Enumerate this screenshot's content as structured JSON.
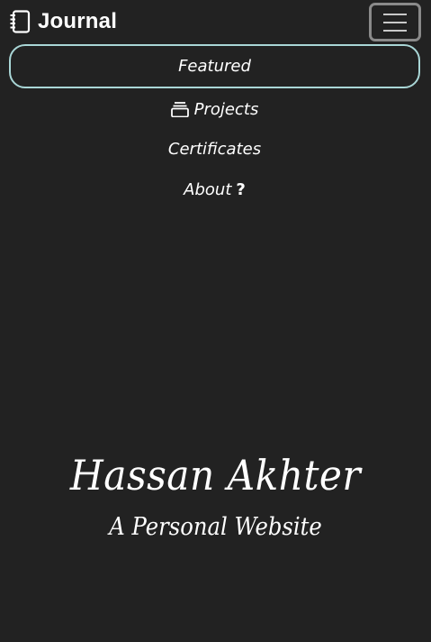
{
  "navbar": {
    "brand_title": "Journal",
    "brand_icon": "notebook-icon",
    "toggler_icon": "hamburger-menu-icon"
  },
  "nav": {
    "items": [
      {
        "label": "Featured",
        "active": true
      },
      {
        "label": "Projects",
        "icon": "folder-stack-icon"
      },
      {
        "label": "Certificates"
      },
      {
        "label": "About",
        "suffix": "?"
      }
    ]
  },
  "hero": {
    "name": "Hassan Akhter",
    "subtitle": "A Personal Website"
  },
  "colors": {
    "background": "#222222",
    "text": "#ffffff",
    "active_border": "#a9d6d6",
    "toggler_border": "#8a8a8a"
  }
}
